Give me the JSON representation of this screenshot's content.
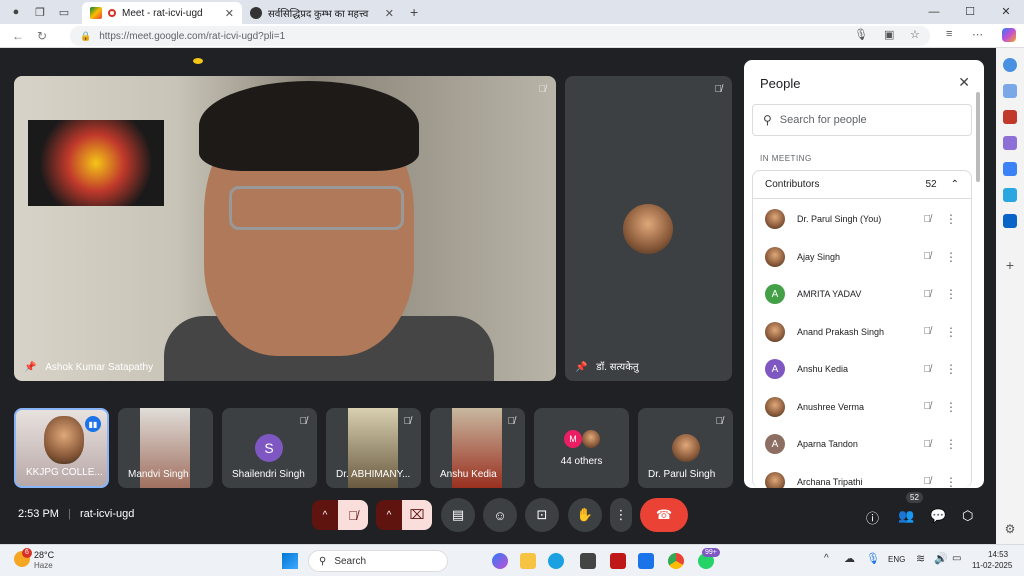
{
  "browser": {
    "tabs": [
      {
        "title": "Meet - rat-icvi-ugd",
        "active": true
      },
      {
        "title": "सर्वसिद्धिप्रद कुम्भ का महत्त्व",
        "active": false
      }
    ],
    "url": "https://meet.google.com/rat-icvi-ugd?pli=1"
  },
  "main_tile": {
    "name": "Ashok Kumar Satapathy"
  },
  "side_tile": {
    "name": "डॉ. सत्यकेतु"
  },
  "bottom_tiles": [
    {
      "name": "KKJPG COLLE..."
    },
    {
      "name": "Mandvi Singh"
    },
    {
      "name": "Shailendri Singh",
      "initial": "S",
      "color": "#7e57c2"
    },
    {
      "name": "Dr. ABHIMANY..."
    },
    {
      "name": "Anshu Kedia"
    },
    {
      "name": "44 others",
      "initial": "M",
      "color": "#e91e63"
    },
    {
      "name": "Dr. Parul Singh"
    }
  ],
  "footer": {
    "time": "2:53 PM",
    "code": "rat-icvi-ugd",
    "people_badge": "52"
  },
  "people_panel": {
    "title": "People",
    "search_placeholder": "Search for people",
    "in_meeting": "IN MEETING",
    "contributors_label": "Contributors",
    "contributors_count": "52",
    "participants": [
      {
        "name": "Dr. Parul Singh (You)",
        "avatar": "photo"
      },
      {
        "name": "Ajay Singh",
        "avatar": "photo"
      },
      {
        "name": "AMRITA YADAV",
        "avatar": "letter",
        "initial": "A",
        "color": "#43a047"
      },
      {
        "name": "Anand Prakash Singh",
        "avatar": "photo"
      },
      {
        "name": "Anshu Kedia",
        "avatar": "letter",
        "initial": "A",
        "color": "#7e57c2"
      },
      {
        "name": "Anushree Verma",
        "avatar": "photo"
      },
      {
        "name": "Aparna Tandon",
        "avatar": "letter",
        "initial": "A",
        "color": "#8d6e63"
      },
      {
        "name": "Archana Tripathi",
        "avatar": "photo"
      }
    ]
  },
  "taskbar": {
    "weather_temp": "28°C",
    "weather_desc": "Haze",
    "search_label": "Search",
    "lang": "ENG",
    "clock_time": "14:53",
    "clock_date": "11-02-2025",
    "notif_badge": "99+",
    "weather_badge": "6"
  },
  "colors": {
    "meet_bg": "#202124",
    "tile_bg": "#3c4043",
    "end_call": "#ea4335",
    "mute_active": "#f9dedc",
    "dark_red": "#601410"
  }
}
